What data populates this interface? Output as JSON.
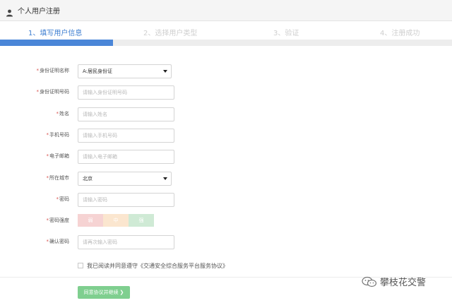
{
  "header": {
    "title": "个人用户注册",
    "icon": "user-icon"
  },
  "steps": [
    {
      "label": "1、填写用户信息",
      "active": true
    },
    {
      "label": "2、选择用户类型",
      "active": false
    },
    {
      "label": "3、验证",
      "active": false
    },
    {
      "label": "4、注册成功",
      "active": false
    }
  ],
  "progress": {
    "fraction": 0.25,
    "color": "#4a86d8"
  },
  "form": {
    "id_type": {
      "label": "身份证明名称",
      "value": "A:居民身份证"
    },
    "id_number": {
      "label": "身份证明号码",
      "placeholder": "请输入身份证明号码"
    },
    "name": {
      "label": "姓名",
      "placeholder": "请输入姓名"
    },
    "phone": {
      "label": "手机号码",
      "placeholder": "请输入手机号码"
    },
    "email": {
      "label": "电子邮箱",
      "placeholder": "请输入电子邮箱"
    },
    "city": {
      "label": "所在城市",
      "value": "北京"
    },
    "password": {
      "label": "密码",
      "placeholder": "请输入密码"
    },
    "strength": {
      "label": "密码强度",
      "segments": [
        {
          "text": "弱",
          "color": "#f6d3d3"
        },
        {
          "text": "中",
          "color": "#fbe6cf"
        },
        {
          "text": "强",
          "color": "#cfead5"
        }
      ]
    },
    "confirm": {
      "label": "确认密码",
      "placeholder": "请再次输入密码"
    },
    "required_mark": "*"
  },
  "agreement": {
    "text": "我已阅读并同意遵守《交通安全综合服务平台服务协议》"
  },
  "submit": {
    "label": "同意协议并继续 ❯"
  },
  "watermark": {
    "text": "攀枝花交警",
    "icon": "wechat-icon"
  }
}
